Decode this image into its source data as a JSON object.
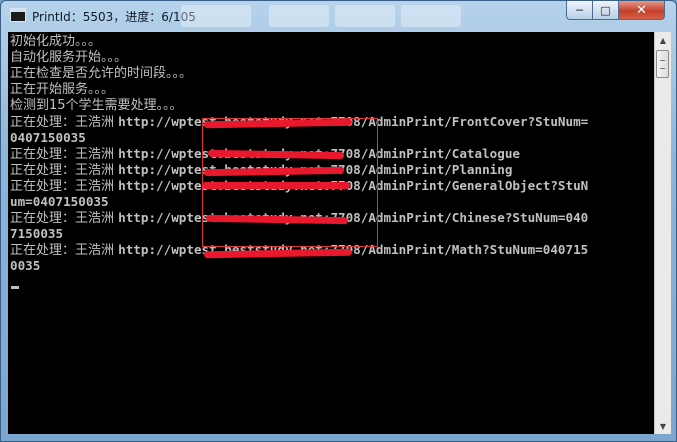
{
  "window": {
    "title": "PrintId：5503，进度：6/105"
  },
  "titlebar_buttons": {
    "minimize": "─",
    "maximize": "□",
    "close": "✕"
  },
  "console": {
    "lines": [
      {
        "text": "初始化成功。。。"
      },
      {
        "text": "自动化服务开始。。。"
      },
      {
        "text": "正在检查是否允许的时间段。。。"
      },
      {
        "text": "正在开始服务。。。"
      },
      {
        "text": "检测到15个学生需要处理。。。"
      },
      {
        "prefix": "正在处理：王浩洲 ",
        "url": "http://wptest.beststudy.net:7708/AdminPrint/FrontCover?StuNum="
      },
      {
        "url": "0407150035"
      },
      {
        "prefix": "正在处理：王浩洲 ",
        "url": "http://wptest.beststudy.net:7708/AdminPrint/Catalogue"
      },
      {
        "prefix": "正在处理：王浩洲 ",
        "url": "http://wptest.beststudy.net:7708/AdminPrint/Planning"
      },
      {
        "prefix": "正在处理：王浩洲 ",
        "url": "http://wptest.beststudy.net:7708/AdminPrint/GeneralObject?StuN"
      },
      {
        "url": "um=0407150035"
      },
      {
        "prefix": "正在处理：王浩洲 ",
        "url": "http://wptest.beststudy.net:7708/AdminPrint/Chinese?StuNum=040"
      },
      {
        "url": "7150035"
      },
      {
        "prefix": "正在处理：王浩洲 ",
        "url": "http://wptest.beststudy.net:7708/AdminPrint/Math?StuNum=040715"
      },
      {
        "url": "0035"
      }
    ]
  },
  "colors": {
    "console_bg": "#000000",
    "console_text": "#c0c0c0",
    "redaction": "#e8192c",
    "close_button": "#c3402b"
  },
  "icons": {
    "app": "console-app-icon",
    "scroll_up": "scroll-up-arrow-icon",
    "scroll_down": "scroll-down-arrow-icon"
  }
}
